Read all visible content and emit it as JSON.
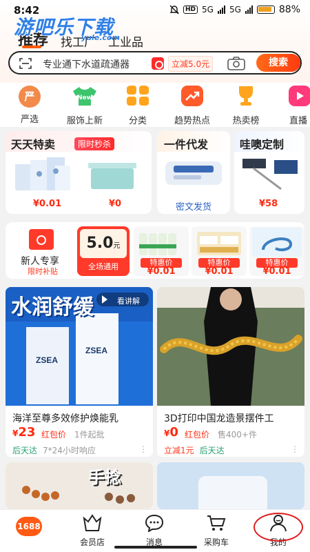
{
  "status_bar": {
    "time": "8:42",
    "hd": "HD",
    "net1": "5G",
    "net2": "5G",
    "battery": "88%"
  },
  "watermark": {
    "text": "游吧乐下载",
    "sub": "yule.com"
  },
  "top_tabs": [
    {
      "label": "推荐"
    },
    {
      "label": "找工厂"
    },
    {
      "label": "工业品"
    }
  ],
  "search": {
    "placeholder": "专业通下水道疏通器",
    "promo": "立减5.0元",
    "button": "搜索"
  },
  "categories": [
    {
      "label": "严选",
      "icon": "yanxuan-icon",
      "icon_text": "严",
      "color": "#f28a4a"
    },
    {
      "label": "服饰上新",
      "icon": "tshirt-icon",
      "icon_text": "New",
      "color": "#3ec46d"
    },
    {
      "label": "分类",
      "icon": "grid-icon",
      "icon_text": "",
      "color": "#ffa41c"
    },
    {
      "label": "趋势热点",
      "icon": "trend-icon",
      "icon_text": "",
      "color": "#ff5a2a"
    },
    {
      "label": "热卖榜",
      "icon": "trophy-icon",
      "icon_text": "",
      "color": "#ffa41c"
    },
    {
      "label": "直播",
      "icon": "live-icon",
      "icon_text": "",
      "color": "#ff3a7a"
    }
  ],
  "daily_special": {
    "title": "天天特卖",
    "tag": "限时秒杀",
    "items": [
      {
        "price": "¥0.01"
      },
      {
        "price": "¥0"
      }
    ]
  },
  "dropship": {
    "title": "一件代发",
    "subtitle": "密文发货"
  },
  "custom": {
    "title": "哇噢定制",
    "price": "¥58"
  },
  "new_user": {
    "title": "新人专享",
    "subtitle": "限时补贴",
    "coupon_amount": "5.0",
    "coupon_unit": "元",
    "coupon_label": "全场通用",
    "deals": [
      {
        "tag": "特惠价",
        "price": "¥0.01"
      },
      {
        "tag": "特惠价",
        "price": "¥0.01"
      },
      {
        "tag": "特惠价",
        "price": "¥0.01"
      }
    ]
  },
  "feed": [
    {
      "image_text": "水润舒缓",
      "image_badge": "看讲解",
      "title": "海洋至尊多效修护焕能乳",
      "price_symbol": "¥",
      "price": "23",
      "red_packet": "红包价",
      "sold": "1件起批",
      "foot_tag": "后天达",
      "foot_note": "7*24小时响应"
    },
    {
      "title": "3D打印中国龙造景摆件工",
      "price_symbol": "¥",
      "price": "0",
      "red_packet": "红包价",
      "sold": "售400+件",
      "foot_tag": "立减1元",
      "foot_note": "后天达"
    },
    {
      "image_text": "手捻"
    },
    {}
  ],
  "bottom_nav": [
    {
      "label": "1688"
    },
    {
      "label": "会员店"
    },
    {
      "label": "消息"
    },
    {
      "label": "采购车"
    },
    {
      "label": "我的"
    }
  ]
}
